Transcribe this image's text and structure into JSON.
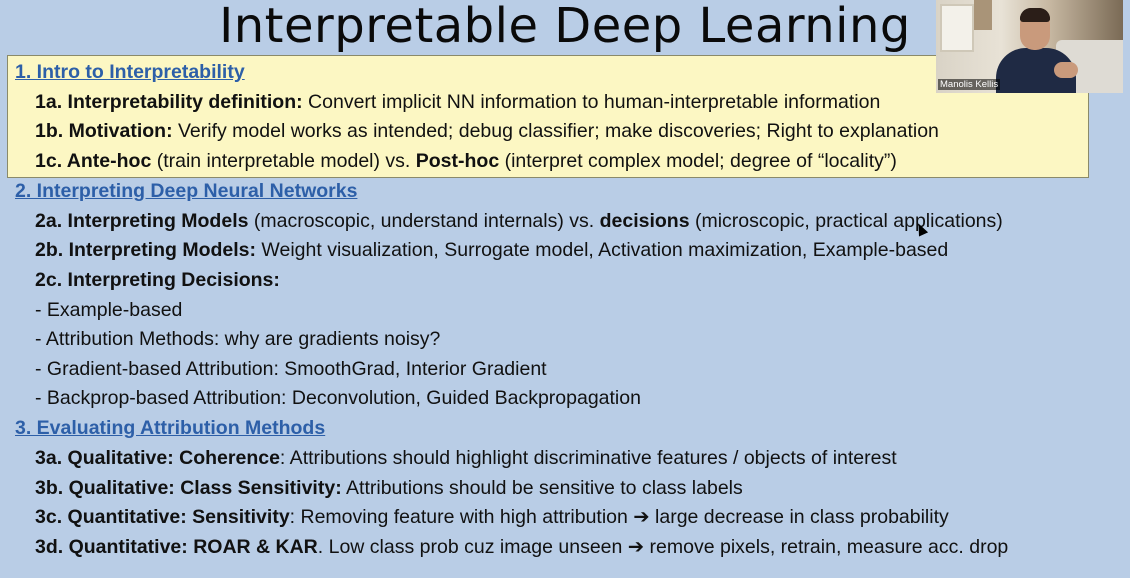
{
  "slide": {
    "title": "Interpretable Deep Learning",
    "lines": [
      {
        "type": "section",
        "text": "1. Intro to Interpretability"
      },
      {
        "type": "item",
        "parts": [
          {
            "b": true,
            "t": "1a. Interpretability definition:"
          },
          {
            "b": false,
            "t": " Convert implicit NN information to human-interpretable information"
          }
        ]
      },
      {
        "type": "item",
        "parts": [
          {
            "b": true,
            "t": "1b. Motivation:"
          },
          {
            "b": false,
            "t": " Verify model works as intended; debug classifier; make discoveries; Right to explanation"
          }
        ]
      },
      {
        "type": "item",
        "parts": [
          {
            "b": true,
            "t": "1c. Ante-hoc"
          },
          {
            "b": false,
            "t": " (train interpretable model) vs. "
          },
          {
            "b": true,
            "t": "Post-hoc"
          },
          {
            "b": false,
            "t": " (interpret complex model; degree of “locality”)"
          }
        ]
      },
      {
        "type": "section",
        "text": "2. Interpreting Deep Neural Networks"
      },
      {
        "type": "item",
        "parts": [
          {
            "b": true,
            "t": "2a. Interpreting Models"
          },
          {
            "b": false,
            "t": " (macroscopic, understand internals) vs. "
          },
          {
            "b": true,
            "t": "decisions"
          },
          {
            "b": false,
            "t": " (microscopic, practical applications)"
          }
        ]
      },
      {
        "type": "item",
        "parts": [
          {
            "b": true,
            "t": "2b. Interpreting Models:"
          },
          {
            "b": false,
            "t": " Weight visualization, Surrogate model, Activation maximization, Example-based"
          }
        ]
      },
      {
        "type": "item",
        "parts": [
          {
            "b": true,
            "t": "2c. Interpreting Decisions:"
          }
        ]
      },
      {
        "type": "item",
        "parts": [
          {
            "b": false,
            "t": "- Example-based"
          }
        ]
      },
      {
        "type": "item",
        "parts": [
          {
            "b": false,
            "t": "- Attribution Methods: why are gradients noisy?"
          }
        ]
      },
      {
        "type": "item",
        "parts": [
          {
            "b": false,
            "t": "- Gradient-based Attribution: SmoothGrad, Interior Gradient"
          }
        ]
      },
      {
        "type": "item",
        "parts": [
          {
            "b": false,
            "t": "- Backprop-based Attribution: Deconvolution, Guided Backpropagation"
          }
        ]
      },
      {
        "type": "section",
        "text": "3. Evaluating Attribution Methods"
      },
      {
        "type": "item",
        "parts": [
          {
            "b": true,
            "t": "3a. Qualitative: Coherence"
          },
          {
            "b": false,
            "t": ": Attributions should highlight discriminative features / objects of interest"
          }
        ]
      },
      {
        "type": "item",
        "parts": [
          {
            "b": true,
            "t": "3b. Qualitative: Class Sensitivity:"
          },
          {
            "b": false,
            "t": " Attributions should be sensitive to class labels"
          }
        ]
      },
      {
        "type": "item",
        "parts": [
          {
            "b": true,
            "t": "3c. Quantitative: Sensitivity"
          },
          {
            "b": false,
            "t": ": Removing feature with high attribution ➔ large decrease in class probability"
          }
        ]
      },
      {
        "type": "item",
        "parts": [
          {
            "b": true,
            "t": "3d. Quantitative: ROAR & KAR"
          },
          {
            "b": false,
            "t": ". Low class prob cuz image unseen ➔ remove pixels, retrain, measure acc. drop"
          }
        ]
      }
    ]
  },
  "video": {
    "participant_name": "Manolis Kellis"
  },
  "colors": {
    "background": "#b9cde6",
    "highlight": "#fcf7c3",
    "section_link": "#2d5fa8"
  }
}
